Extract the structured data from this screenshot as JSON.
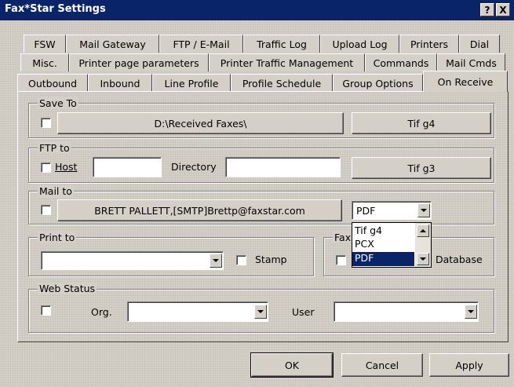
{
  "window": {
    "title": "Fax*Star Settings",
    "help_btn": "?",
    "close_btn": "X"
  },
  "tabs_row1": [
    "FSW",
    "Mail Gateway",
    "FTP / E-Mail",
    "Traffic Log",
    "Upload Log",
    "Printers",
    "Dial"
  ],
  "tabs_row2": [
    "Misc.",
    "Printer page parameters",
    "Printer Traffic Management",
    "Commands",
    "Mail Cmds"
  ],
  "tabs_row3": [
    "Outbound",
    "Inbound",
    "Line Profile",
    "Profile Schedule",
    "Group Options",
    "On Receive"
  ],
  "save_to": {
    "label": "Save To",
    "path_button": "D:\\Received Faxes\\",
    "format_button": "Tif g4"
  },
  "ftp_to": {
    "label": "FTP to",
    "host_label": "Host",
    "host_value": "",
    "directory_label": "Directory",
    "directory_value": "",
    "format_button": "Tif g3"
  },
  "mail_to": {
    "label": "Mail to",
    "address_button": "BRETT PALLETT,[SMTP]Brettp@faxstar.com",
    "format_value": "PDF",
    "format_options": [
      "Tif g4",
      "PCX",
      "PDF"
    ],
    "selected_index": 2
  },
  "print_to": {
    "label": "Print to",
    "printer_value": "",
    "stamp_label": "Stamp"
  },
  "fax_db": {
    "label_visible": "Fax",
    "database_label": "Database"
  },
  "web_status": {
    "label": "Web Status",
    "org_label": "Org.",
    "org_value": "",
    "user_label": "User",
    "user_value": ""
  },
  "footer": {
    "ok": "OK",
    "cancel": "Cancel",
    "apply": "Apply"
  },
  "colors": {
    "titlebar": "#0a246a",
    "face": "#d4d0c8",
    "highlight": "#0a246a"
  }
}
